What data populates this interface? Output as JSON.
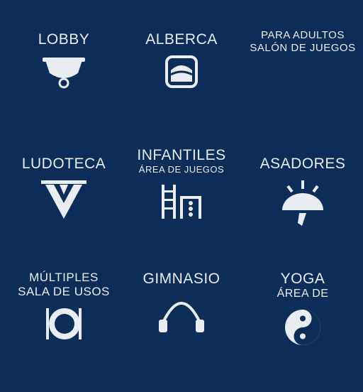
{
  "colors": {
    "background": "#0b2d57",
    "foreground": "#e9edf2"
  },
  "amenities": [
    {
      "title": "LOBBY",
      "icon": "bell-lamp-icon"
    },
    {
      "title": "ALBERCA",
      "icon": "pool-icon"
    },
    {
      "title_line1": "PARA ADULTOS",
      "title_line2": "SALÓN DE JUEGOS",
      "icon": "adult-games-icon"
    },
    {
      "title": "LUDOTECA",
      "icon": "ludoteca-icon"
    },
    {
      "title": "INFANTILES",
      "subtitle": "ÁREA DE JUEGOS",
      "icon": "playground-icon"
    },
    {
      "title": "ASADORES",
      "icon": "grill-icon"
    },
    {
      "title": "MÚLTIPLES",
      "subtitle": "SALA DE USOS",
      "icon": "dining-icon"
    },
    {
      "title": "GIMNASIO",
      "icon": "jump-rope-icon"
    },
    {
      "title": "YOGA",
      "subtitle": "ÁREA DE",
      "icon": "yin-yang-icon"
    }
  ]
}
